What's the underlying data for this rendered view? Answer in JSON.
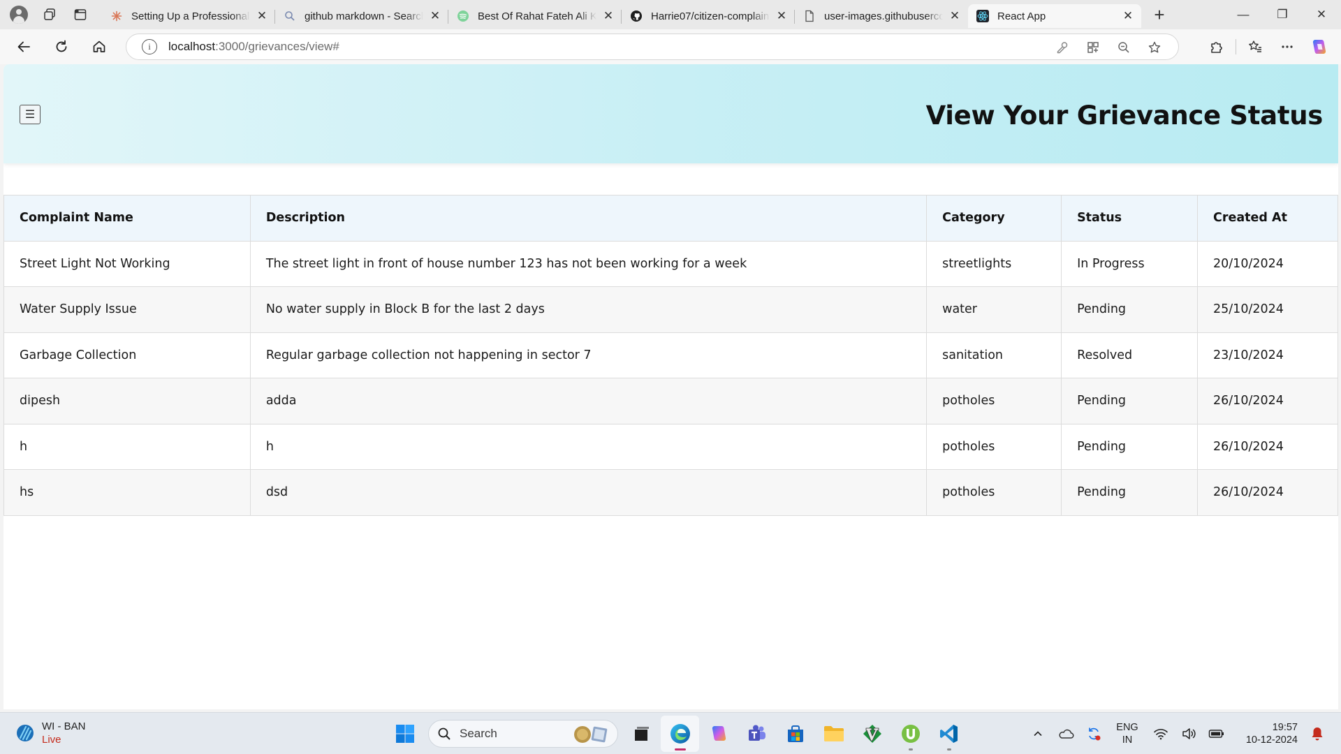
{
  "browser": {
    "tabs": [
      {
        "title": "Setting Up a Professional",
        "favicon": "claude-sunburst-icon",
        "active": false
      },
      {
        "title": "github markdown - Search",
        "favicon": "search-icon",
        "active": false
      },
      {
        "title": "Best Of Rahat Fateh Ali Khan",
        "favicon": "spotify-icon",
        "active": false
      },
      {
        "title": "Harrie07/citizen-complaint",
        "favicon": "github-icon",
        "active": false
      },
      {
        "title": "user-images.githubusercontent",
        "favicon": "document-icon",
        "active": false
      },
      {
        "title": "React App",
        "favicon": "react-icon",
        "active": true
      }
    ],
    "tab_close_glyph": "✕",
    "new_tab_glyph": "+",
    "address": {
      "host": "localhost",
      "rest": ":3000/grievances/view#"
    },
    "window_controls": {
      "minimize": "—",
      "restore": "❐",
      "close": "✕"
    }
  },
  "app": {
    "menu_glyph": "☰",
    "title": "View Your Grievance Status",
    "table": {
      "headers": {
        "name": "Complaint Name",
        "description": "Description",
        "category": "Category",
        "status": "Status",
        "created": "Created At"
      },
      "rows": [
        {
          "name": "Street Light Not Working",
          "description": "The street light in front of house number 123 has not been working for a week",
          "category": "streetlights",
          "status": "In Progress",
          "created": "20/10/2024"
        },
        {
          "name": "Water Supply Issue",
          "description": "No water supply in Block B for the last 2 days",
          "category": "water",
          "status": "Pending",
          "created": "25/10/2024"
        },
        {
          "name": "Garbage Collection",
          "description": "Regular garbage collection not happening in sector 7",
          "category": "sanitation",
          "status": "Resolved",
          "created": "23/10/2024"
        },
        {
          "name": "dipesh",
          "description": "adda",
          "category": "potholes",
          "status": "Pending",
          "created": "26/10/2024"
        },
        {
          "name": "h",
          "description": "h",
          "category": "potholes",
          "status": "Pending",
          "created": "26/10/2024"
        },
        {
          "name": "hs",
          "description": "dsd",
          "category": "potholes",
          "status": "Pending",
          "created": "26/10/2024"
        }
      ]
    }
  },
  "taskbar": {
    "weather": {
      "line1": "WI - BAN",
      "line2": "Live"
    },
    "search_label": "Search",
    "lang": {
      "line1": "ENG",
      "line2": "IN"
    },
    "clock": {
      "time": "19:57",
      "date": "10-12-2024"
    },
    "colors": {
      "accent_live": "#c42b1c",
      "active_indicator": "#c42b6a"
    }
  }
}
